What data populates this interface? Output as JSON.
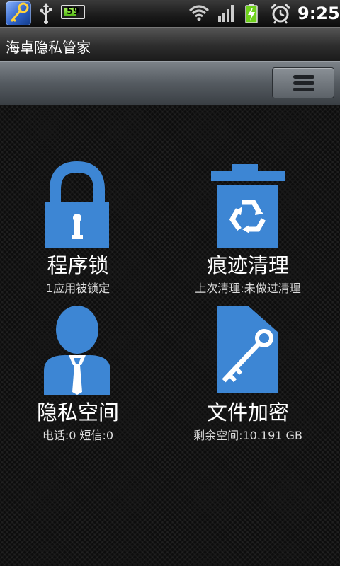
{
  "status_bar": {
    "battery_level": "59",
    "time": "9:25"
  },
  "app_bar": {
    "title": "海卓隐私管家"
  },
  "colors": {
    "icon_blue": "#3d86d4",
    "background": "#0d0d0d",
    "battery_green": "#6fd11c"
  },
  "tiles": [
    {
      "id": "app-lock",
      "icon": "padlock-icon",
      "label": "程序锁",
      "subtitle": "1应用被锁定"
    },
    {
      "id": "trace-clean",
      "icon": "recycle-bin-icon",
      "label": "痕迹清理",
      "subtitle": "上次清理:未做过清理"
    },
    {
      "id": "private-space",
      "icon": "person-icon",
      "label": "隐私空间",
      "subtitle": "电话:0 短信:0"
    },
    {
      "id": "file-encrypt",
      "icon": "key-file-icon",
      "label": "文件加密",
      "subtitle": "剩余空间:10.191 GB"
    }
  ]
}
